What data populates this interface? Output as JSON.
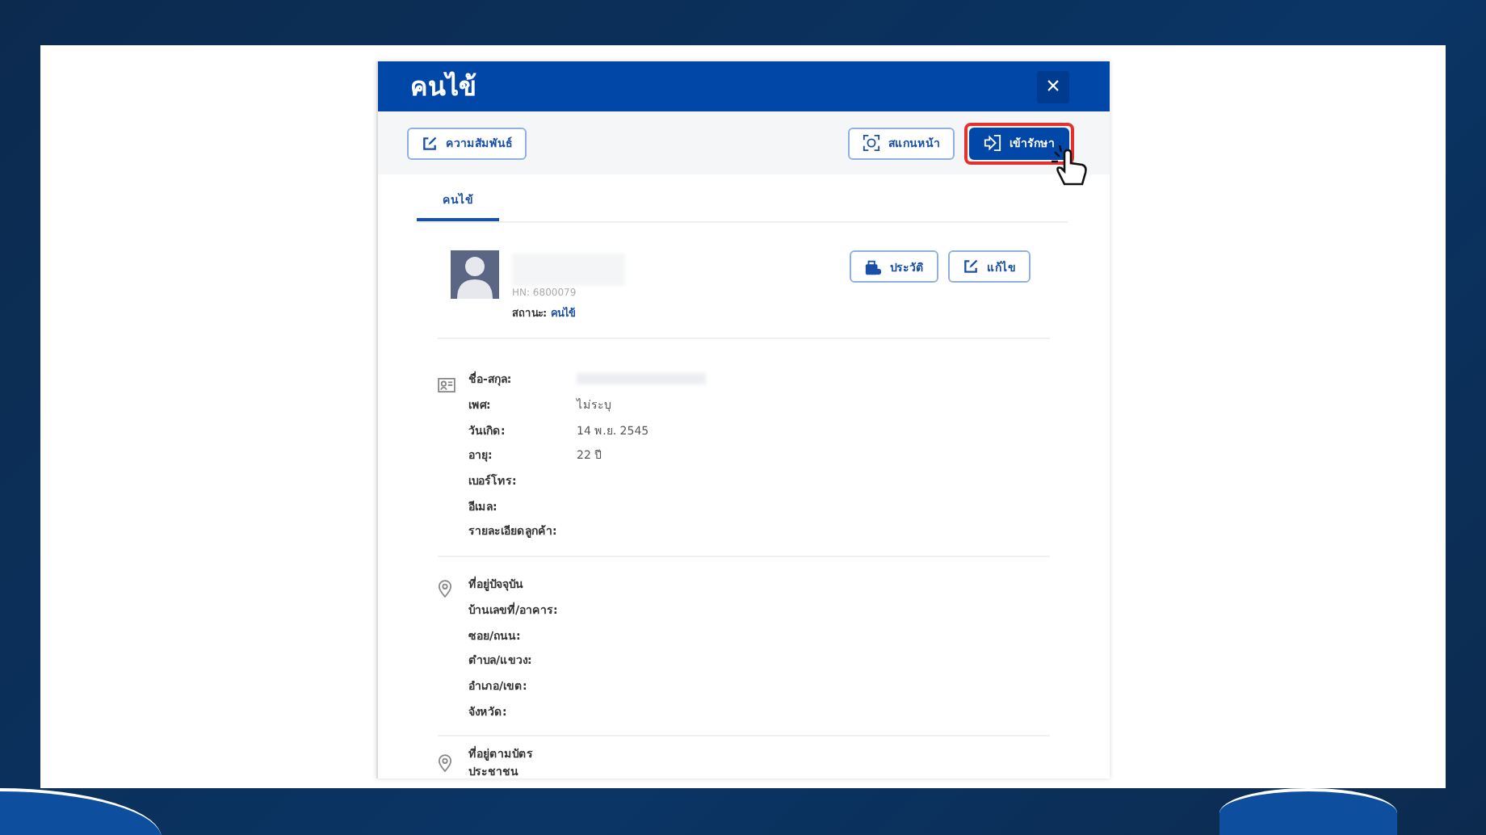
{
  "dialog": {
    "title": "คนไข้",
    "close": "×"
  },
  "toolbar": {
    "left_button": "ความสัมพันธ์",
    "right_buttons": [
      {
        "label": "สแกนหน้า",
        "kind": "outline",
        "highlighted": false
      },
      {
        "label": "เข้ารักษา",
        "kind": "primary",
        "highlighted": true
      }
    ]
  },
  "tabs": [
    {
      "label": "คนไข้",
      "selected": true
    }
  ],
  "profile": {
    "hn": "HN: 6800079",
    "status_label": "สถานะ:",
    "status_value": "คนไข้",
    "buttons": [
      "ประวัติ",
      "แก้ไข"
    ]
  },
  "personal": {
    "fields": [
      {
        "label": "ชื่อ-สกุล:",
        "blurred": true
      },
      {
        "label": "เพศ:",
        "value": "ไม่ระบุ",
        "blurred": false
      },
      {
        "label": "วันเกิด:",
        "value": "14 พ.ย. 2545",
        "blurred": false
      },
      {
        "label": "อายุ:",
        "value": "22 ปี",
        "blurred": false
      },
      {
        "label": "เบอร์โทร:",
        "blurred": false
      },
      {
        "label": "อีเมล:",
        "blurred": false
      },
      {
        "label": "รายละเอียดลูกค้า:",
        "blurred": false
      }
    ]
  },
  "current_address": {
    "heading": "ที่อยู่ปัจจุบัน",
    "fields": [
      "บ้านเลขที่/อาคาร:",
      "ซอย/ถนน:",
      "ตำบล/แขวง:",
      "อำเภอ/เขต:",
      "จังหวัด:"
    ]
  },
  "id_card_address": {
    "heading": "ที่อยู่ตามบัตรประชาชน"
  }
}
